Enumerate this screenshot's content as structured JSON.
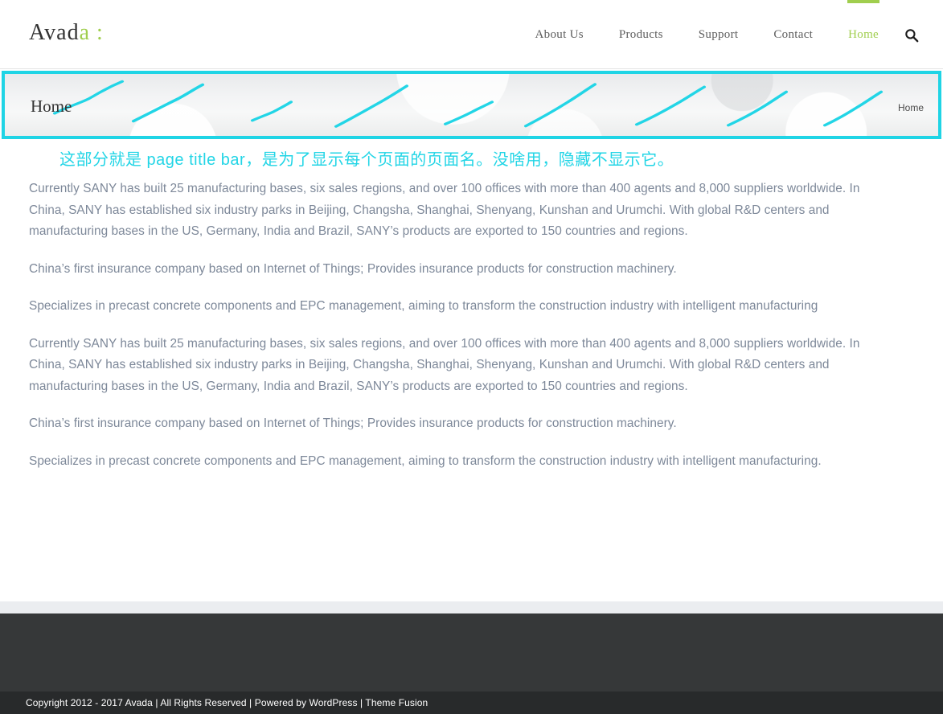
{
  "theme": {
    "accent_green": "#a0ce4e",
    "annotation_cyan": "#22d5e6",
    "body_text": "#7d8899",
    "footer_bg": "#363839",
    "copyright_bg": "#282a2b",
    "divider_band": "#ebedf0"
  },
  "header": {
    "logo_main": "Avad",
    "logo_accent": "a :",
    "nav": [
      {
        "label": "About Us",
        "active": false
      },
      {
        "label": "Products",
        "active": false
      },
      {
        "label": "Support",
        "active": false
      },
      {
        "label": "Contact",
        "active": false
      },
      {
        "label": "Home",
        "active": true
      }
    ],
    "search_icon": "search-icon"
  },
  "page_title_bar": {
    "title": "Home",
    "breadcrumb": "Home",
    "highlight_border_color": "#1fd4e5",
    "scribble_count": 9
  },
  "annotation": {
    "text": "这部分就是 page title bar，是为了显示每个页面的页面名。没啥用，隐藏不显示它。"
  },
  "content": {
    "paragraphs": [
      "Currently SANY has built 25 manufacturing bases, six sales regions, and over 100 offices with more than 400 agents and 8,000 suppliers worldwide. In China, SANY has established six industry parks in Beijing, Changsha, Shanghai, Shenyang, Kunshan and Urumchi. With global R&D centers and manufacturing bases in the US, Germany, India and Brazil, SANY’s products are exported to 150 countries and regions.",
      "China’s first insurance company based on Internet of Things; Provides insurance products for construction machinery.",
      "Specializes in precast concrete components and EPC management, aiming to transform the construction industry with intelligent manufacturing",
      "Currently SANY has built 25 manufacturing bases, six sales regions, and over 100 offices with more than 400 agents and 8,000 suppliers worldwide. In China, SANY has established six industry parks in Beijing, Changsha, Shanghai, Shenyang, Kunshan and Urumchi. With global R&D centers and manufacturing bases in the US, Germany, India and Brazil, SANY’s products are exported to 150 countries and regions.",
      "China’s first insurance company based on Internet of Things; Provides insurance products for construction machinery.",
      "Specializes in precast concrete components and EPC management, aiming to transform the construction industry with intelligent manufacturing."
    ]
  },
  "footer": {
    "copyright": "Copyright 2012 - 2017 Avada | All Rights Reserved | Powered by WordPress | Theme Fusion"
  }
}
